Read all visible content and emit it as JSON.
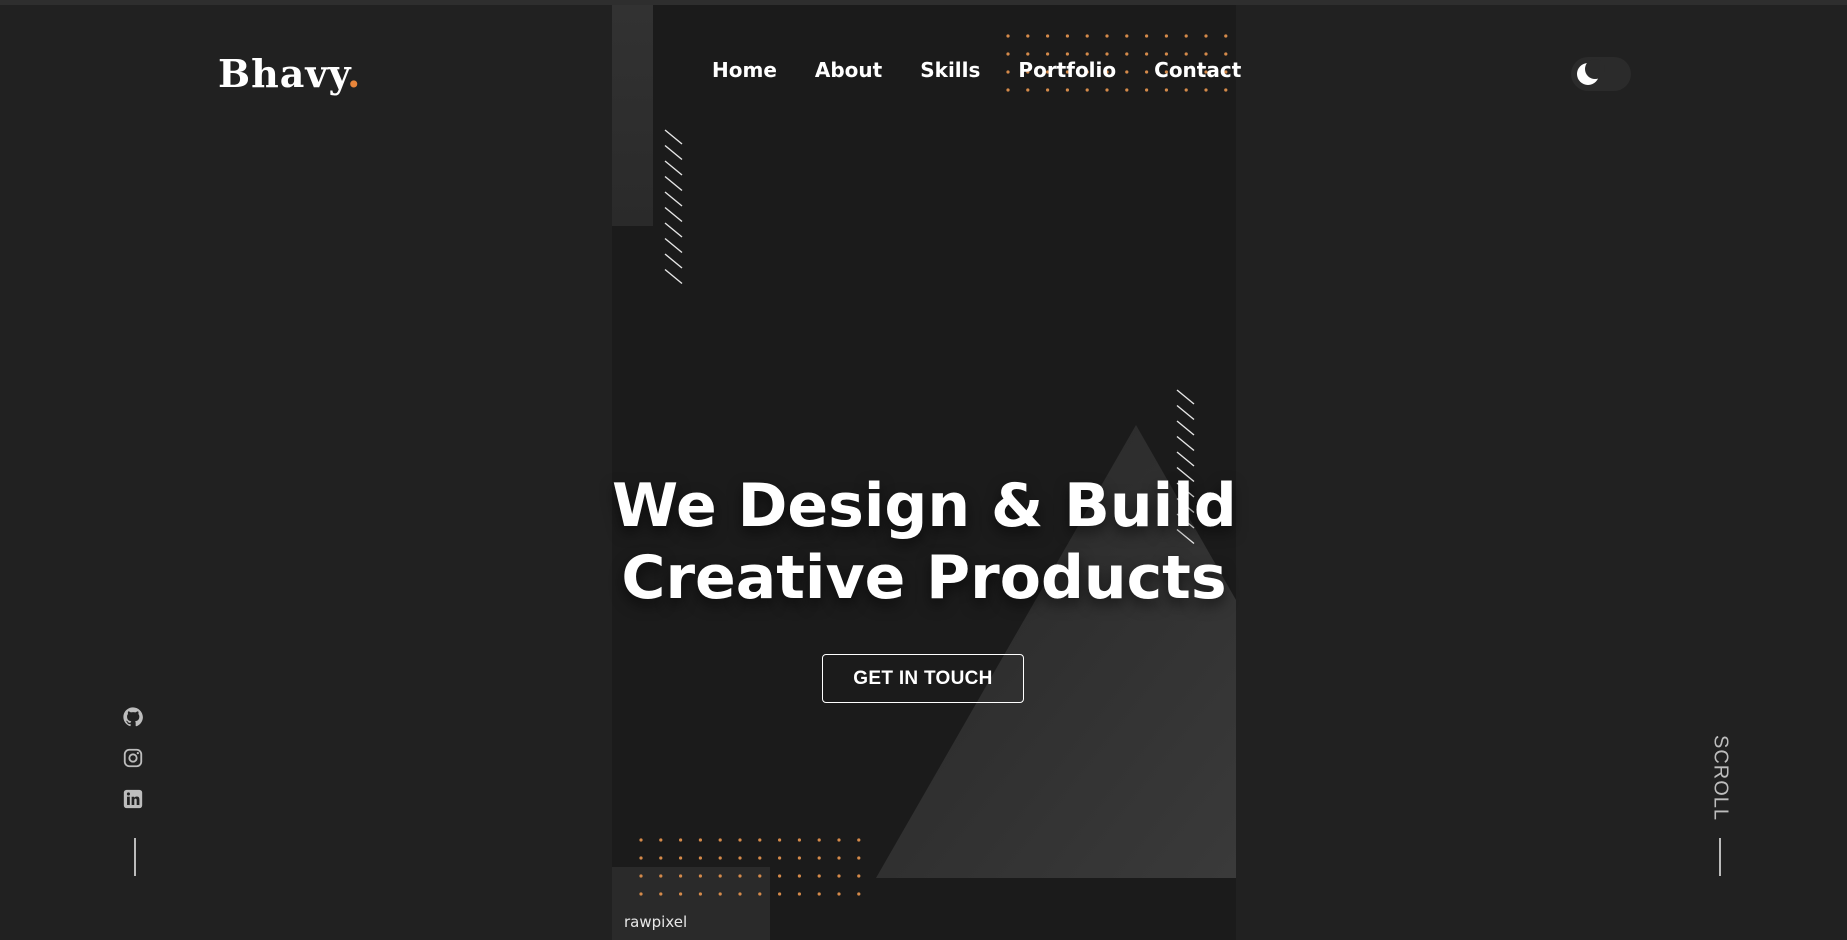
{
  "brand": {
    "name": "Bhavy",
    "suffix": ".",
    "accent_color": "#e8853a"
  },
  "nav": {
    "items": [
      {
        "label": "Home"
      },
      {
        "label": "About"
      },
      {
        "label": "Skills"
      },
      {
        "label": "Portfolio"
      },
      {
        "label": "Contact"
      }
    ]
  },
  "theme_toggle": {
    "icon": "moon-icon",
    "mode": "dark"
  },
  "hero": {
    "title_line1": "We Design & Build",
    "title_line2": "Creative Products",
    "cta_label": "GET IN TOUCH",
    "image_credit": "rawpixel"
  },
  "social": {
    "icons": [
      "github-icon",
      "instagram-icon",
      "linkedin-icon"
    ]
  },
  "scroll_indicator": {
    "label": "SCROLL"
  },
  "colors": {
    "background": "#212121",
    "panel": "#1b1b1b",
    "accent": "#e8853a",
    "text": "#ffffff"
  }
}
